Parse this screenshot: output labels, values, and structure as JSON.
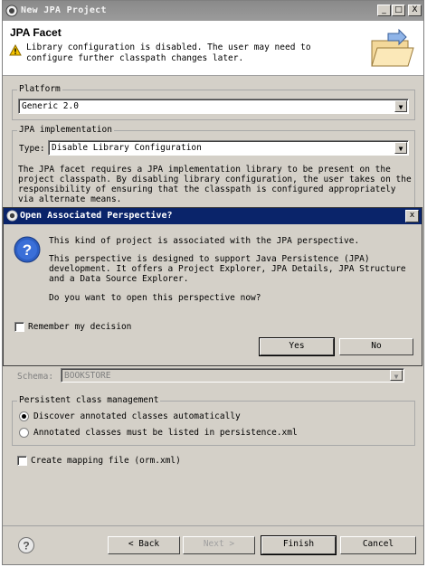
{
  "window": {
    "title": "New JPA Project",
    "min": "_",
    "max": "□",
    "close": "X"
  },
  "header": {
    "title": "JPA Facet",
    "message": "Library configuration is disabled. The user may need to configure further classpath changes later."
  },
  "platform": {
    "label": "Platform",
    "value": "Generic 2.0"
  },
  "jpa_impl": {
    "label": "JPA implementation",
    "type_label": "Type:",
    "type_value": "Disable Library Configuration",
    "description": "The JPA facet requires a JPA implementation library to be present on the project classpath. By disabling library configuration, the user takes on the responsibility of ensuring that the classpath is configured appropriately via alternate means."
  },
  "dialog": {
    "title": "Open Associated Perspective?",
    "close": "x",
    "line1": "This kind of project is associated with the JPA perspective.",
    "line2": "This perspective is designed to support Java Persistence (JPA) development. It offers a Project Explorer, JPA Details, JPA Structure and a Data Source Explorer.",
    "line3": "Do you want to open this perspective now?",
    "remember": "Remember my decision",
    "yes": "Yes",
    "no": "No"
  },
  "schema": {
    "label": "Schema:",
    "value": "BOOKSTORE"
  },
  "persistent": {
    "label": "Persistent class management",
    "option1": "Discover annotated classes automatically",
    "option2": "Annotated classes must be listed in persistence.xml"
  },
  "mapping": {
    "label": "Create mapping file (orm.xml)"
  },
  "buttons": {
    "back": "< Back",
    "next": "Next >",
    "finish": "Finish",
    "cancel": "Cancel"
  }
}
